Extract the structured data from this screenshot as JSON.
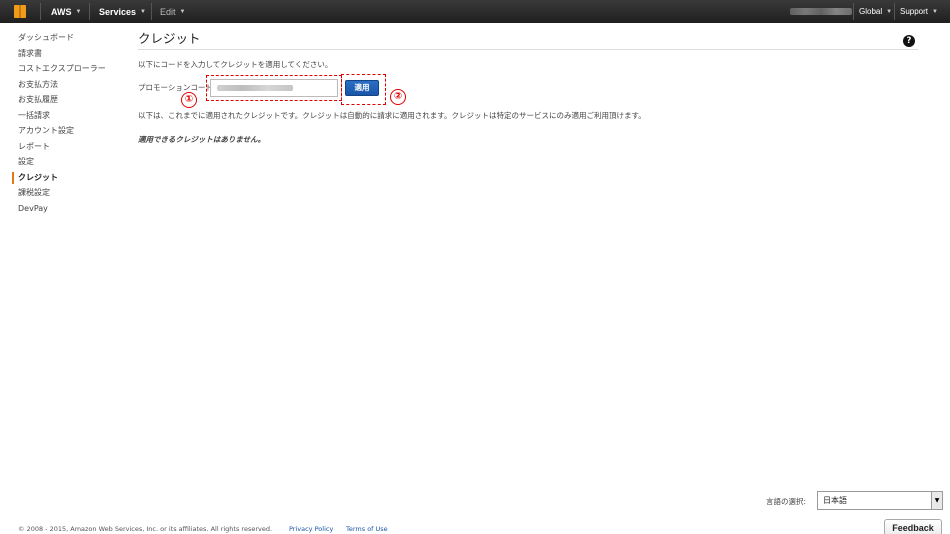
{
  "topbar": {
    "logo_icon": "aws-cube-icon",
    "brand": "AWS",
    "services": "Services",
    "edit": "Edit",
    "region": "Global",
    "support": "Support"
  },
  "sidebar": {
    "items": [
      {
        "label": "ダッシュボード"
      },
      {
        "label": "請求書"
      },
      {
        "label": "コストエクスプローラー"
      },
      {
        "label": "お支払方法"
      },
      {
        "label": "お支払履歴"
      },
      {
        "label": "一括請求"
      },
      {
        "label": "アカウント設定"
      },
      {
        "label": "レポート"
      },
      {
        "label": "設定"
      },
      {
        "label": "クレジット"
      },
      {
        "label": "課税設定"
      },
      {
        "label": "DevPay"
      }
    ],
    "active_index": 9
  },
  "main": {
    "title": "クレジット",
    "instruction": "以下にコードを入力してクレジットを適用してください。",
    "promo_label": "プロモーションコード",
    "promo_value": "",
    "apply_label": "適用",
    "annotation_1": "①",
    "annotation_2": "②",
    "credit_description": "以下は、これまでに適用されたクレジットです。クレジットは自動的に請求に適用されます。クレジットは特定のサービスにのみ適用ご利用頂けます。",
    "no_credits": "適用できるクレジットはありません。"
  },
  "footer": {
    "language_label": "言語の選択:",
    "language_value": "日本語",
    "copyright": "© 2008 - 2015, Amazon Web Services, Inc. or its affiliates. All rights reserved.",
    "privacy": "Privacy Policy",
    "terms": "Terms of Use",
    "feedback": "Feedback"
  },
  "colors": {
    "nav_bg": "#2b2b2b",
    "accent": "#e47911",
    "button_blue": "#1a56a8",
    "annotation_red": "#e00000"
  }
}
